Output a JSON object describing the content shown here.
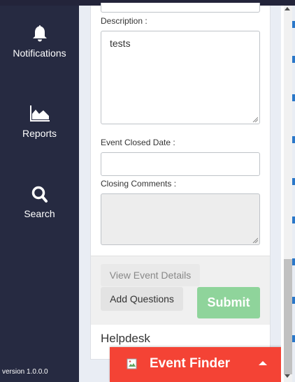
{
  "sidebar": {
    "items": [
      {
        "label": "Notifications",
        "icon": "bell-icon"
      },
      {
        "label": "Reports",
        "icon": "area-chart-icon"
      },
      {
        "label": "Search",
        "icon": "search-icon"
      }
    ],
    "version": "version 1.0.0.0"
  },
  "form": {
    "description_label": "Description :",
    "description_value": "tests",
    "closed_date_label": "Event Closed Date :",
    "closed_date_value": "",
    "closing_comments_label": "Closing Comments :",
    "closing_comments_value": ""
  },
  "actions": {
    "view_details": "View Event Details",
    "add_questions": "Add Questions",
    "submit": "Submit"
  },
  "helpdesk_label": "Helpdesk",
  "event_finder": {
    "label": "Event Finder",
    "icon": "broken-image-icon",
    "caret": "caret-up-icon"
  },
  "colors": {
    "sidebar_bg": "#262a41",
    "submit_bg": "#8fd49b",
    "event_finder_bg": "#f44335"
  }
}
